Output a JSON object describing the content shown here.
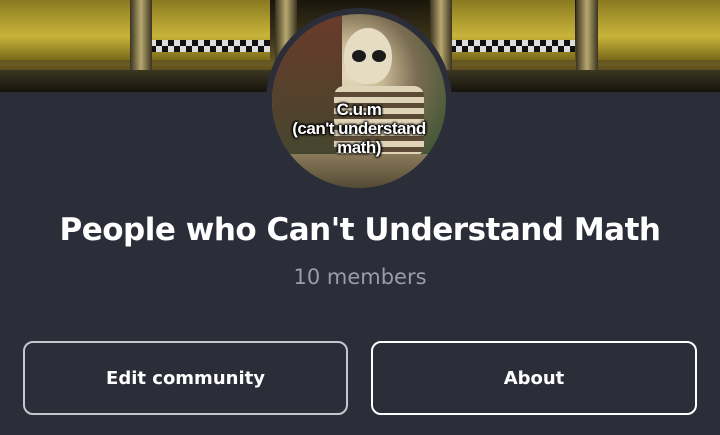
{
  "community": {
    "avatar_caption": "C.u.m\n(can't understand\nmath)",
    "name": "People who Can't Understand Math",
    "members": "10 members"
  },
  "actions": {
    "edit_label": "Edit community",
    "about_label": "About"
  },
  "colors": {
    "background": "#2b2d38",
    "text_primary": "#ffffff",
    "text_secondary": "#9a9ca8",
    "button_border": "#c5c7cf"
  }
}
